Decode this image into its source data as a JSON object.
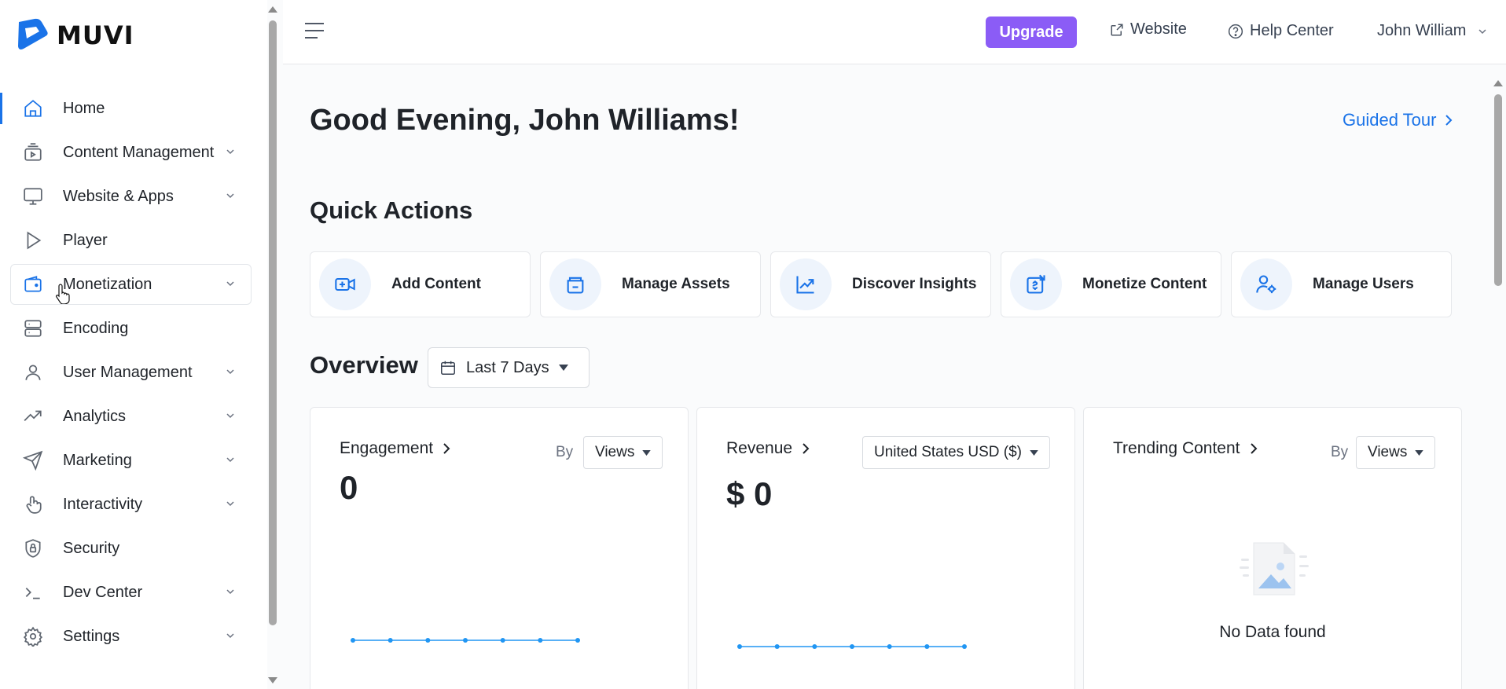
{
  "brand": {
    "name": "MUVI",
    "color": "#1a73e8"
  },
  "sidebar": {
    "items": [
      {
        "label": "Home",
        "icon": "home-icon",
        "expandable": false,
        "active": true
      },
      {
        "label": "Content Management",
        "icon": "content-icon",
        "expandable": true
      },
      {
        "label": "Website & Apps",
        "icon": "monitor-icon",
        "expandable": true
      },
      {
        "label": "Player",
        "icon": "play-icon",
        "expandable": false
      },
      {
        "label": "Monetization",
        "icon": "wallet-icon",
        "expandable": true,
        "hovered": true
      },
      {
        "label": "Encoding",
        "icon": "server-icon",
        "expandable": false
      },
      {
        "label": "User Management",
        "icon": "user-icon",
        "expandable": true
      },
      {
        "label": "Analytics",
        "icon": "trend-icon",
        "expandable": true
      },
      {
        "label": "Marketing",
        "icon": "send-icon",
        "expandable": true
      },
      {
        "label": "Interactivity",
        "icon": "touch-icon",
        "expandable": true
      },
      {
        "label": "Security",
        "icon": "shield-icon",
        "expandable": false
      },
      {
        "label": "Dev Center",
        "icon": "terminal-icon",
        "expandable": true
      },
      {
        "label": "Settings",
        "icon": "gear-icon",
        "expandable": true
      }
    ]
  },
  "topbar": {
    "upgrade": "Upgrade",
    "upgrade_color": "#8b5cf6",
    "website": "Website",
    "help": "Help Center",
    "user": "John William"
  },
  "main": {
    "greeting": "Good Evening, John Williams!",
    "guided_tour": "Guided Tour",
    "quick_actions_title": "Quick Actions",
    "quick_actions": [
      {
        "label": "Add Content",
        "icon": "add-video-icon"
      },
      {
        "label": "Manage Assets",
        "icon": "assets-icon"
      },
      {
        "label": "Discover Insights",
        "icon": "chart-icon"
      },
      {
        "label": "Monetize Content",
        "icon": "monetize-icon"
      },
      {
        "label": "Manage Users",
        "icon": "user-settings-icon"
      }
    ],
    "overview_title": "Overview",
    "date_range": "Last 7 Days",
    "cards": {
      "engagement": {
        "title": "Engagement",
        "by": "By",
        "select": "Views",
        "value": "0"
      },
      "revenue": {
        "title": "Revenue",
        "select": "United States USD ($)",
        "value": "$ 0"
      },
      "trending": {
        "title": "Trending Content",
        "by": "By",
        "select": "Views",
        "empty": "No Data found"
      }
    }
  },
  "chart_data": [
    {
      "type": "line",
      "name": "engagement",
      "values": [
        0,
        0,
        0,
        0,
        0,
        0,
        0
      ],
      "color": "#2196f3"
    },
    {
      "type": "line",
      "name": "revenue",
      "values": [
        0,
        0,
        0,
        0,
        0,
        0,
        0
      ],
      "color": "#2196f3"
    }
  ]
}
